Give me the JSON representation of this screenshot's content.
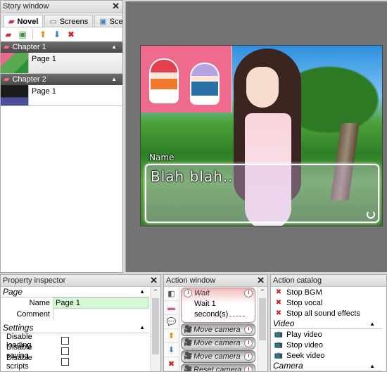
{
  "story_window": {
    "title": "Story window",
    "close": "✕",
    "tabs": [
      {
        "label": "Novel",
        "icon": "book-icon",
        "active": true
      },
      {
        "label": "Screens",
        "icon": "screen-icon",
        "active": false
      },
      {
        "label": "Scer",
        "icon": "scene-icon",
        "active": false
      }
    ],
    "toolbar": [
      {
        "name": "add-chapter-icon",
        "glyph": "✚"
      },
      {
        "name": "add-page-icon",
        "glyph": "✚"
      },
      {
        "name": "move-up-icon",
        "glyph": "▲"
      },
      {
        "name": "move-down-icon",
        "glyph": "▼"
      },
      {
        "name": "delete-icon",
        "glyph": "✖"
      }
    ],
    "chapters": [
      {
        "label": "Chapter 1",
        "pages": [
          {
            "label": "Page 1",
            "selected": true
          }
        ]
      },
      {
        "label": "Chapter 2",
        "pages": [
          {
            "label": "Page 1",
            "selected": false
          }
        ]
      }
    ]
  },
  "stage": {
    "speaker": "Name",
    "dialog_text": "Blah blah.."
  },
  "property_inspector": {
    "title": "Property inspector",
    "close": "✕",
    "sections": {
      "page": "Page",
      "settings": "Settings"
    },
    "fields": {
      "name_label": "Name",
      "name_value": "Page 1",
      "comment_label": "Comment",
      "comment_value": ""
    },
    "checkboxes": [
      {
        "label": "Disable loading",
        "checked": false
      },
      {
        "label": "Disable saving",
        "checked": false
      },
      {
        "label": "Disable scripts",
        "checked": false
      }
    ]
  },
  "action_window": {
    "title": "Action window",
    "close": "✕",
    "wait": {
      "title": "Wait",
      "line1": "Wait 1",
      "line2": "second(s)"
    },
    "actions": [
      "Move camera",
      "Move camera",
      "Move camera",
      "Reset camera"
    ]
  },
  "action_catalog": {
    "title": "Action catalog",
    "audio_items": [
      "Stop BGM",
      "Stop vocal",
      "Stop all sound effects"
    ],
    "video_section": "Video",
    "video_items": [
      "Play video",
      "Stop video",
      "Seek video"
    ],
    "camera_section": "Camera"
  }
}
